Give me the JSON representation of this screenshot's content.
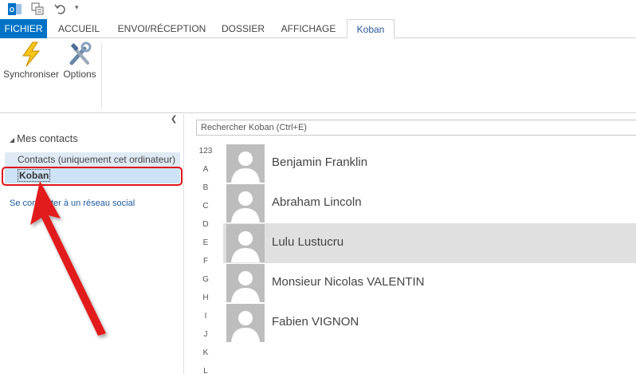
{
  "ribbon_tabs": [
    "FICHIER",
    "ACCUEIL",
    "ENVOI/RÉCEPTION",
    "DOSSIER",
    "AFFICHAGE",
    "Koban"
  ],
  "ribbon_buttons": {
    "sync": "Synchroniser",
    "options": "Options"
  },
  "nav": {
    "header": "Mes contacts",
    "items": [
      "Contacts (uniquement cet ordinateur)",
      "Koban"
    ],
    "social_link": "Se connecter à un réseau social"
  },
  "search": {
    "placeholder": "Rechercher Koban (Ctrl+E)"
  },
  "alphabet": [
    "123",
    "A",
    "B",
    "C",
    "D",
    "E",
    "F",
    "G",
    "H",
    "I",
    "J",
    "K",
    "L"
  ],
  "contacts": [
    "Benjamin Franklin",
    "Abraham Lincoln",
    "Lulu Lustucru",
    "Monsieur Nicolas VALENTIN",
    "Fabien VIGNON"
  ],
  "selected_contact": "Lulu Lustucru",
  "colors": {
    "file_tab": "#0072c6",
    "annotation": "#e0141b",
    "selection": "#e0e0e0",
    "nav_selected": "#cde2f4"
  }
}
